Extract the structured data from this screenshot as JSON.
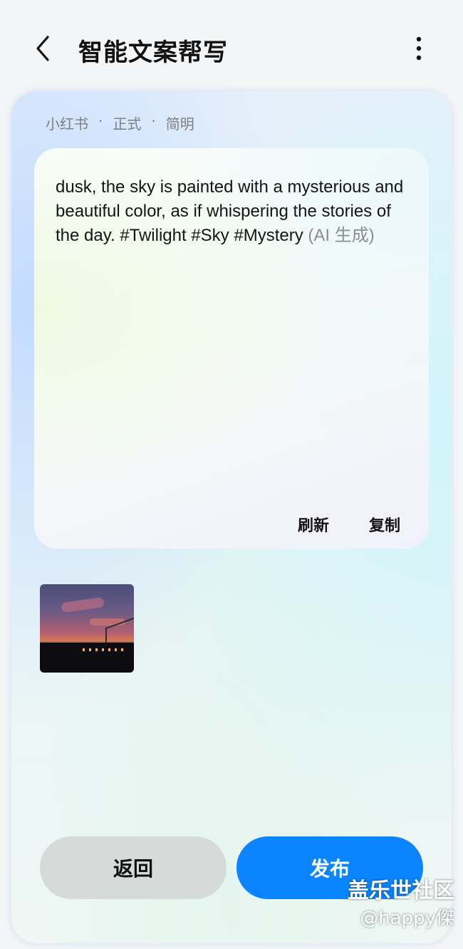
{
  "header": {
    "title": "智能文案帮写",
    "back_icon": "chevron-left-icon",
    "more_icon": "more-vertical-icon"
  },
  "tags": [
    "小红书",
    "正式",
    "简明"
  ],
  "tag_separator": "·",
  "generated": {
    "text": "dusk, the sky is painted with a mysterious and beautiful color, as if whispering the stories of the day. #Twilight #Sky #Mystery",
    "ai_label": "(AI 生成)"
  },
  "panel_actions": {
    "refresh_label": "刷新",
    "copy_label": "复制"
  },
  "buttons": {
    "back_label": "返回",
    "publish_label": "发布",
    "publish_color": "#0a84ff",
    "back_color": "#d6dbd9"
  },
  "watermark": {
    "line1": "盖乐世社区",
    "line2": "@happy傑"
  }
}
